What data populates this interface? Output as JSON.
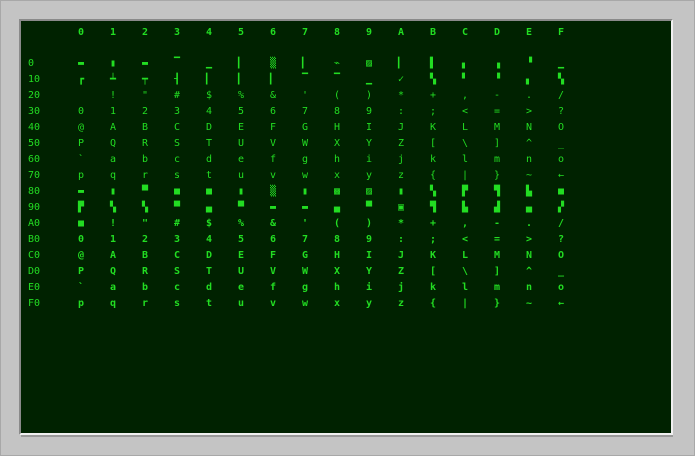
{
  "screen": {
    "fg_color": "#22dd22",
    "bg_color": "#002200",
    "bezel_color": "#c4c4c4"
  },
  "columns": [
    "0",
    "1",
    "2",
    "3",
    "4",
    "5",
    "6",
    "7",
    "8",
    "9",
    "A",
    "B",
    "C",
    "D",
    "E",
    "F"
  ],
  "rows": [
    {
      "label": "0",
      "cells": [
        "▬",
        "▮",
        "▬",
        "▔",
        "▁",
        "▎",
        "▒",
        "▎",
        "⌁",
        "▨",
        "▎",
        "▌",
        "▖",
        "▗",
        "▝",
        "▁"
      ]
    },
    {
      "label": "10",
      "cells": [
        "┏",
        "┷",
        "┯",
        "┨",
        "▎",
        "▎",
        "▎",
        "▔",
        "▔",
        "▁",
        "✓",
        "▚",
        "▘",
        "▝",
        "▖",
        "▚"
      ]
    },
    {
      "label": "20",
      "cells": [
        " ",
        "!",
        "\"",
        "#",
        "$",
        "%",
        "&",
        "'",
        "(",
        ")",
        "*",
        "+",
        ",",
        "-",
        ".",
        "/"
      ]
    },
    {
      "label": "30",
      "cells": [
        "0",
        "1",
        "2",
        "3",
        "4",
        "5",
        "6",
        "7",
        "8",
        "9",
        ":",
        ";",
        "<",
        "=",
        ">",
        "?"
      ]
    },
    {
      "label": "40",
      "cells": [
        "@",
        "A",
        "B",
        "C",
        "D",
        "E",
        "F",
        "G",
        "H",
        "I",
        "J",
        "K",
        "L",
        "M",
        "N",
        "O"
      ]
    },
    {
      "label": "50",
      "cells": [
        "P",
        "Q",
        "R",
        "S",
        "T",
        "U",
        "V",
        "W",
        "X",
        "Y",
        "Z",
        "[",
        "\\",
        "]",
        "^",
        "_"
      ]
    },
    {
      "label": "60",
      "cells": [
        "`",
        "a",
        "b",
        "c",
        "d",
        "e",
        "f",
        "g",
        "h",
        "i",
        "j",
        "k",
        "l",
        "m",
        "n",
        "o"
      ]
    },
    {
      "label": "70",
      "cells": [
        "p",
        "q",
        "r",
        "s",
        "t",
        "u",
        "v",
        "w",
        "x",
        "y",
        "z",
        "{",
        "|",
        "}",
        "~",
        "←"
      ]
    },
    {
      "label": "80",
      "cells": [
        "▬",
        "▮",
        "▀",
        "■",
        "■",
        "▮",
        "▒",
        "▮",
        "▩",
        "▨",
        "▮",
        "▚",
        "▛",
        "▜",
        "▙",
        "■"
      ]
    },
    {
      "label": "90",
      "cells": [
        "▛",
        "▚",
        "▚",
        "▀",
        "▄",
        "▀",
        "▬",
        "▬",
        "▄",
        "▀",
        "▣",
        "▜",
        "▙",
        "▟",
        "▄",
        "▞"
      ]
    },
    {
      "label": "A0",
      "cells": [
        "■",
        "!",
        "\"",
        "#",
        "$",
        "%",
        "&",
        "'",
        "(",
        ")",
        "*",
        "+",
        ",",
        "-",
        ".",
        "/"
      ]
    },
    {
      "label": "B0",
      "cells": [
        "0",
        "1",
        "2",
        "3",
        "4",
        "5",
        "6",
        "7",
        "8",
        "9",
        ":",
        ";",
        "<",
        "=",
        ">",
        "?"
      ]
    },
    {
      "label": "C0",
      "cells": [
        "@",
        "A",
        "B",
        "C",
        "D",
        "E",
        "F",
        "G",
        "H",
        "I",
        "J",
        "K",
        "L",
        "M",
        "N",
        "O"
      ]
    },
    {
      "label": "D0",
      "cells": [
        "P",
        "Q",
        "R",
        "S",
        "T",
        "U",
        "V",
        "W",
        "X",
        "Y",
        "Z",
        "[",
        "\\",
        "]",
        "^",
        "_"
      ]
    },
    {
      "label": "E0",
      "cells": [
        "`",
        "a",
        "b",
        "c",
        "d",
        "e",
        "f",
        "g",
        "h",
        "i",
        "j",
        "k",
        "l",
        "m",
        "n",
        "o"
      ]
    },
    {
      "label": "F0",
      "cells": [
        "p",
        "q",
        "r",
        "s",
        "t",
        "u",
        "v",
        "w",
        "x",
        "y",
        "z",
        "{",
        "|",
        "}",
        "~",
        "←"
      ]
    }
  ]
}
